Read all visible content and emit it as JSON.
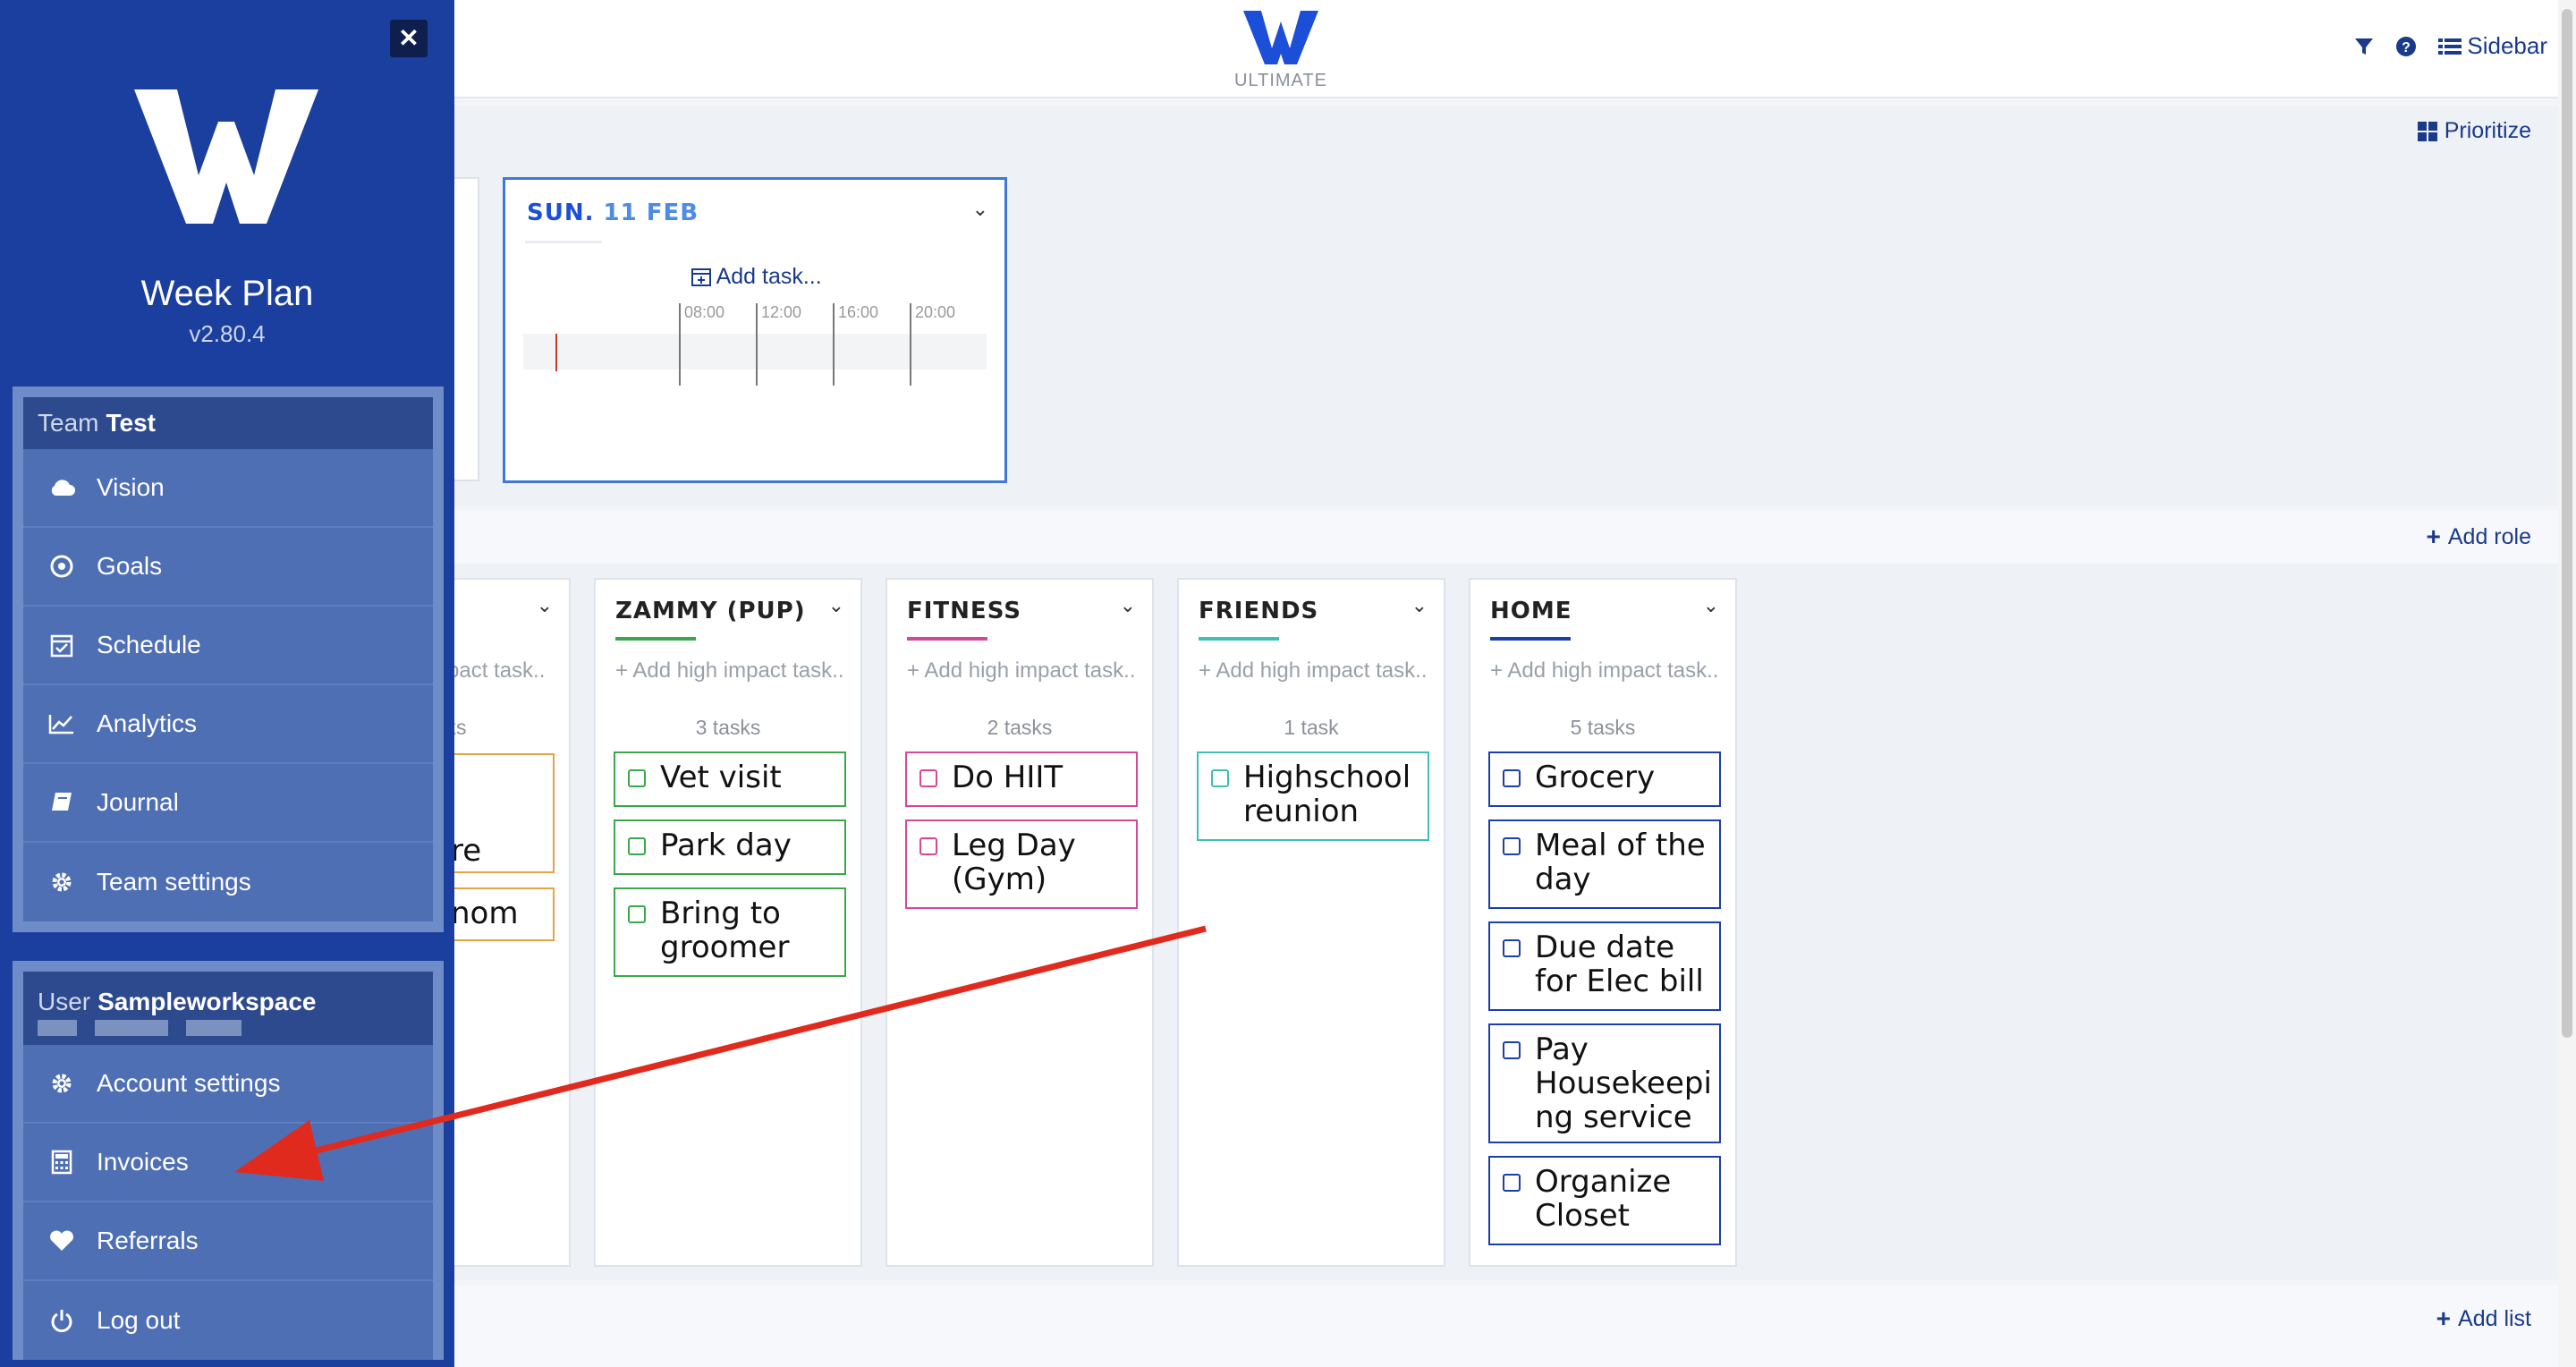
{
  "topbar": {
    "logo_text": "W",
    "logo_sub": "ULTIMATE",
    "sidebar_label": "Sidebar",
    "filter_icon": "filter-icon",
    "help_icon": "help-icon"
  },
  "band1": {
    "prioritize_label": "Prioritize"
  },
  "day_card": {
    "day": "SUN.",
    "date": "11 FEB",
    "add_task": "Add task...",
    "ticks": [
      "08:00",
      "12:00",
      "16:00",
      "20:00"
    ]
  },
  "band2": {
    "add_role_label": "Add role"
  },
  "band3": {
    "add_list_label": "Add list"
  },
  "columns": [
    {
      "title": "",
      "add": "pact task..",
      "count": "ks",
      "tasks": [
        "re",
        "nom"
      ]
    },
    {
      "title": "ZAMMY (PUP)",
      "add": "Add high impact task..",
      "count": "3 tasks",
      "tasks": [
        "Vet visit",
        "Park day",
        "Bring to groomer"
      ]
    },
    {
      "title": "FITNESS",
      "add": "Add high impact task..",
      "count": "2 tasks",
      "tasks": [
        "Do HIIT",
        "Leg Day (Gym)"
      ]
    },
    {
      "title": "FRIENDS",
      "add": "Add high impact task..",
      "count": "1 task",
      "tasks": [
        "Highschool reunion"
      ]
    },
    {
      "title": "HOME",
      "add": "Add high impact task..",
      "count": "5 tasks",
      "tasks": [
        "Grocery",
        "Meal of the day",
        "Due date for Elec bill",
        "Pay Housekeepi ng service",
        "Organize Closet"
      ]
    }
  ],
  "colors": {
    "accent": "#1c4fd8",
    "sidebar": "#1b3f9e",
    "zammy": "#3aa84a",
    "fitness": "#d6479a",
    "friends": "#3cbfb4",
    "home": "#1c3fa8",
    "arrow": "#e02a1e"
  },
  "sidebar": {
    "app_name": "Week Plan",
    "version": "v2.80.4",
    "team_label": "Team",
    "team_name": "Test",
    "team_items": [
      {
        "label": "Vision",
        "icon": "cloud-icon"
      },
      {
        "label": "Goals",
        "icon": "target-icon"
      },
      {
        "label": "Schedule",
        "icon": "calendar-check-icon"
      },
      {
        "label": "Analytics",
        "icon": "line-chart-icon"
      },
      {
        "label": "Journal",
        "icon": "book-icon"
      },
      {
        "label": "Team settings",
        "icon": "gear-icon"
      }
    ],
    "user_label": "User",
    "user_name": "Sampleworkspace",
    "user_items": [
      {
        "label": "Account settings",
        "icon": "gear-icon"
      },
      {
        "label": "Invoices",
        "icon": "calculator-icon"
      },
      {
        "label": "Referrals",
        "icon": "heart-icon"
      },
      {
        "label": "Log out",
        "icon": "power-icon"
      }
    ]
  }
}
